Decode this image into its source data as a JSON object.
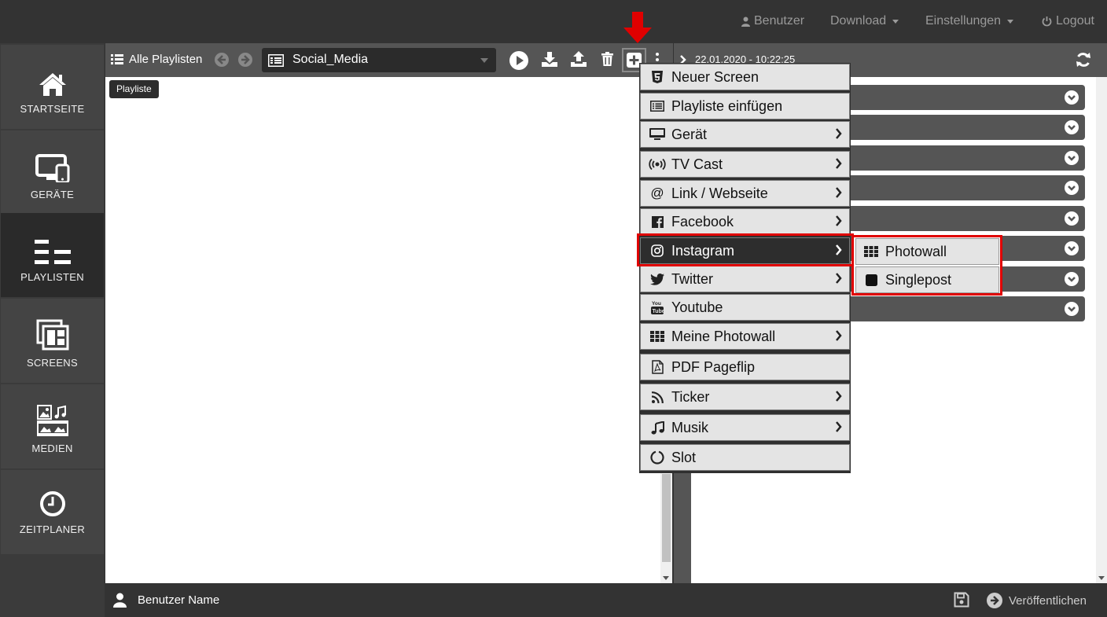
{
  "topbar": {
    "user_label": "Benutzer",
    "download_label": "Download",
    "settings_label": "Einstellungen",
    "logout_label": "Logout"
  },
  "sidebar": {
    "items": [
      {
        "label": "STARTSEITE",
        "icon": "home-icon"
      },
      {
        "label": "GERÄTE",
        "icon": "devices-icon"
      },
      {
        "label": "PLAYLISTEN",
        "icon": "playlist-icon",
        "active": true
      },
      {
        "label": "SCREENS",
        "icon": "screens-icon"
      },
      {
        "label": "MEDIEN",
        "icon": "media-icon"
      },
      {
        "label": "ZEITPLANER",
        "icon": "clock-icon"
      }
    ]
  },
  "toolbar": {
    "all_playlists_label": "Alle Playlisten",
    "playlist_name": "Social_Media",
    "datetime": "22.01.2020 - 10:22:25"
  },
  "tooltip": "Playliste",
  "menu": {
    "items": [
      {
        "label": "Neuer Screen",
        "icon": "html5-icon",
        "submenu": false
      },
      {
        "label": "Playliste einfügen",
        "icon": "list-icon",
        "submenu": false
      },
      {
        "label": "Gerät",
        "icon": "monitor-icon",
        "submenu": true
      },
      {
        "label": "TV Cast",
        "icon": "broadcast-icon",
        "submenu": true
      },
      {
        "label": "Link / Webseite",
        "icon": "at-icon",
        "submenu": true
      },
      {
        "label": "Facebook",
        "icon": "facebook-icon",
        "submenu": true
      },
      {
        "label": "Instagram",
        "icon": "instagram-icon",
        "submenu": true,
        "active": true
      },
      {
        "label": "Twitter",
        "icon": "twitter-icon",
        "submenu": true
      },
      {
        "label": "Youtube",
        "icon": "youtube-icon",
        "submenu": false
      },
      {
        "label": "Meine Photowall",
        "icon": "grid-icon",
        "submenu": true
      },
      {
        "label": "PDF Pageflip",
        "icon": "pdf-icon",
        "submenu": false
      },
      {
        "label": "Ticker",
        "icon": "rss-icon",
        "submenu": true
      },
      {
        "label": "Musik",
        "icon": "music-icon",
        "submenu": true
      },
      {
        "label": "Slot",
        "icon": "circle-icon",
        "submenu": false
      }
    ]
  },
  "submenu": {
    "items": [
      {
        "label": "Photowall",
        "icon": "grid-icon"
      },
      {
        "label": "Singlepost",
        "icon": "square-icon"
      }
    ]
  },
  "bottombar": {
    "user_name": "Benutzer Name",
    "publish_label": "Veröffentlichen"
  },
  "colors": {
    "highlight": "#e00000",
    "bar_bg": "#333333",
    "toolbar_bg": "#555555",
    "menu_bg": "#e4e4e4"
  }
}
